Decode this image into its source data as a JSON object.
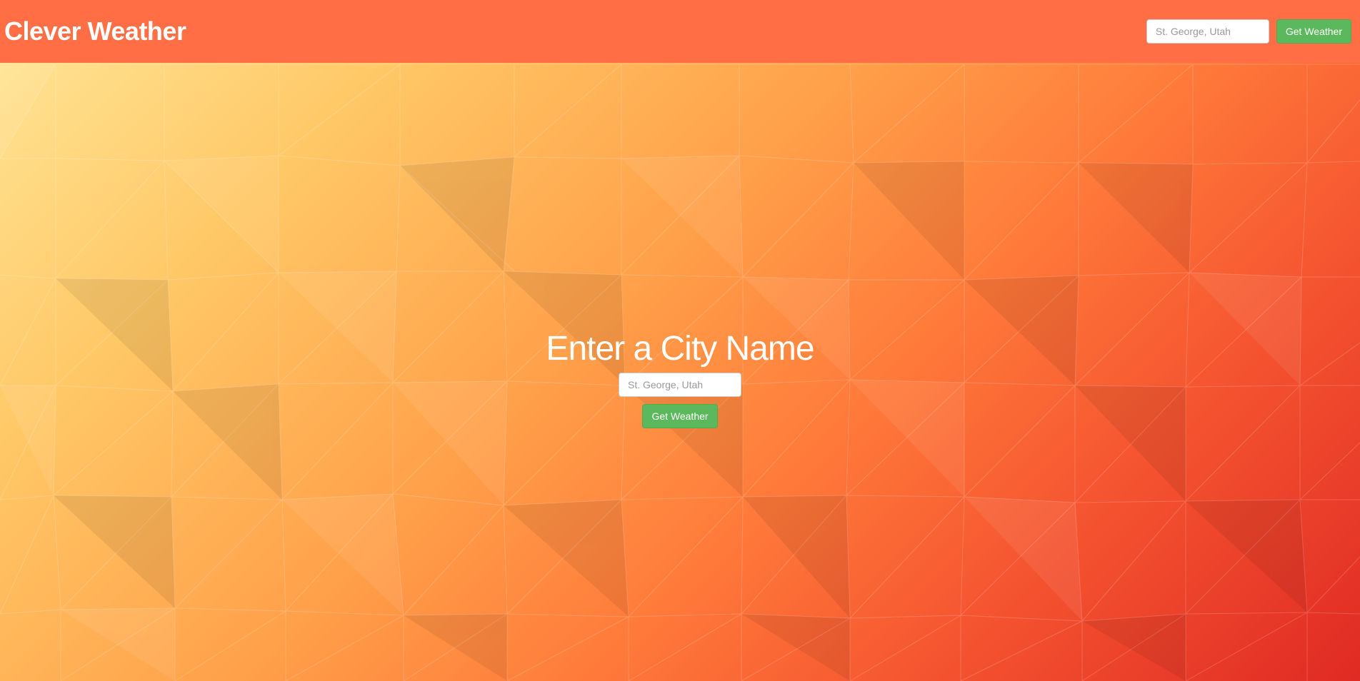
{
  "navbar": {
    "brand": "Clever Weather",
    "search_placeholder": "St. George, Utah",
    "button_label": "Get Weather"
  },
  "hero": {
    "title": "Enter a City Name",
    "search_placeholder": "St. George, Utah",
    "button_label": "Get Weather"
  },
  "colors": {
    "navbar": "#ff6e45",
    "button": "#5cb85c",
    "text": "#ffffff"
  }
}
